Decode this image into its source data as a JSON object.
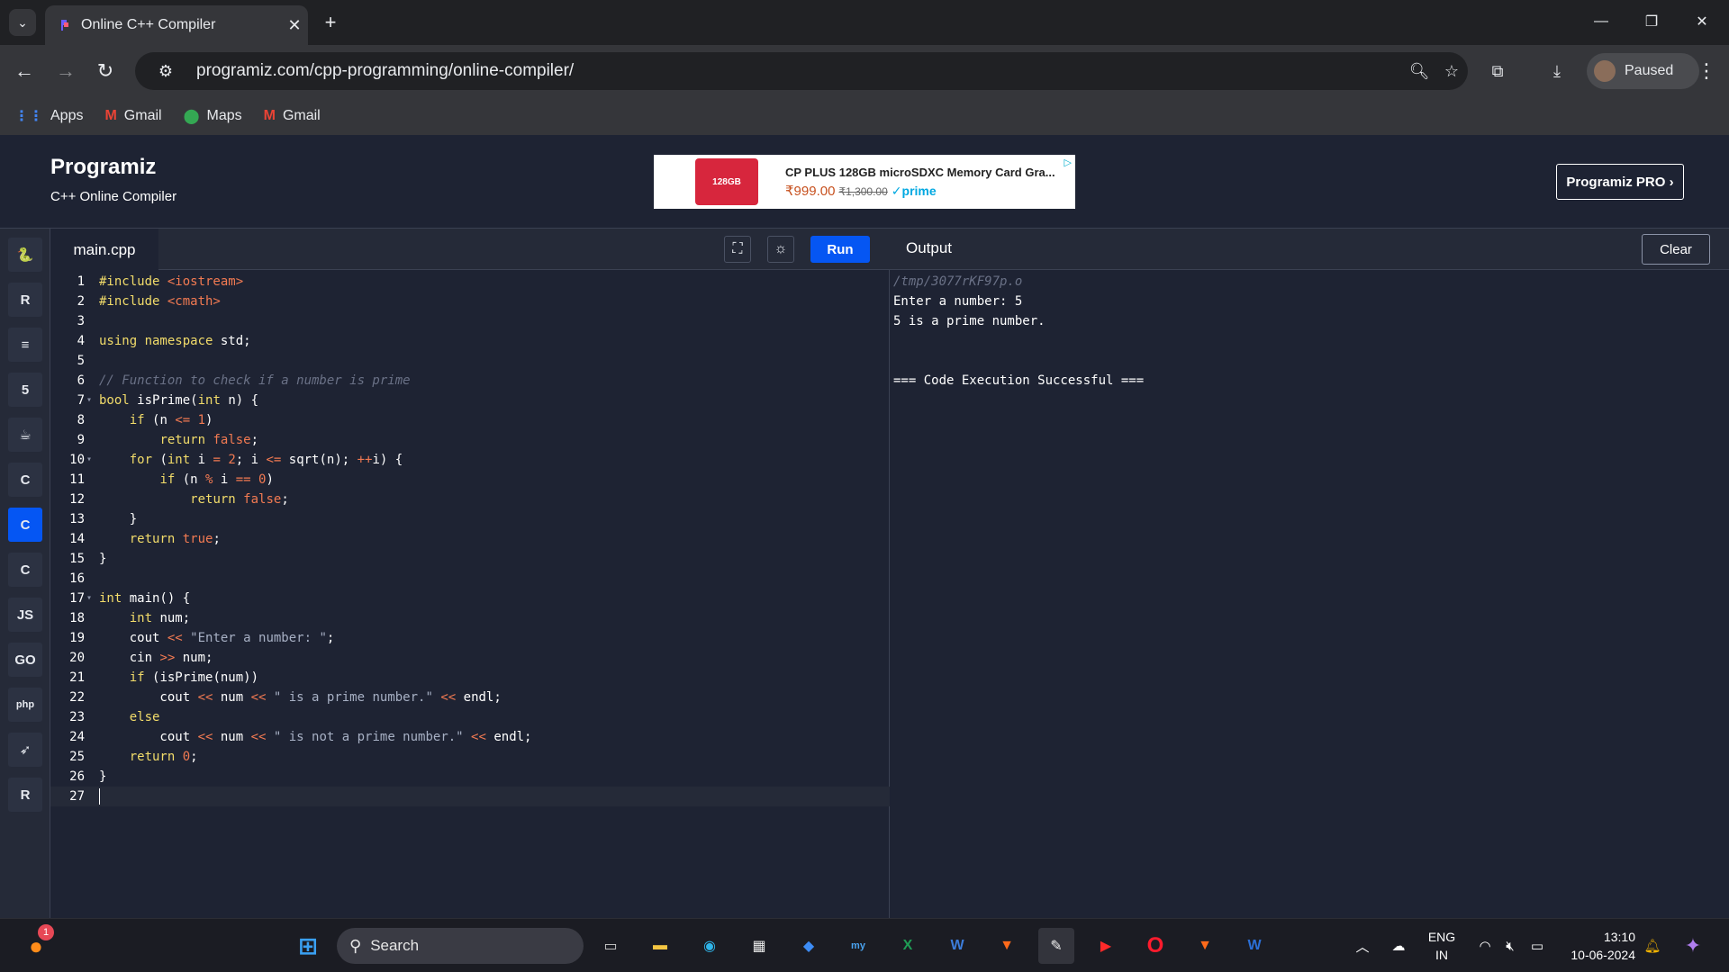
{
  "browser": {
    "tab_title": "Online C++ Compiler",
    "url": "programiz.com/cpp-programming/online-compiler/",
    "profile_status": "Paused",
    "bookmarks": [
      {
        "label": "Apps",
        "icon": "apps-grid-icon"
      },
      {
        "label": "Gmail",
        "icon": "gmail-icon"
      },
      {
        "label": "Maps",
        "icon": "maps-icon"
      },
      {
        "label": "Gmail",
        "icon": "gmail-icon"
      }
    ]
  },
  "site": {
    "logo": "Programiz",
    "subtitle": "C++ Online Compiler",
    "pro_button": "Programiz PRO ›",
    "ad": {
      "brand": "CP PLUS",
      "badge": "128GB",
      "title": "CP PLUS 128GB microSDXC Memory Card Gra...",
      "price": "₹999.00",
      "old_price": "₹1,300.00",
      "prime": "✓prime"
    }
  },
  "languages": [
    {
      "name": "python-icon",
      "glyph": "🐍"
    },
    {
      "name": "r-icon",
      "glyph": "R"
    },
    {
      "name": "sql-icon",
      "glyph": "≡"
    },
    {
      "name": "html-icon",
      "glyph": "5"
    },
    {
      "name": "java-icon",
      "glyph": "☕"
    },
    {
      "name": "c-icon",
      "glyph": "C"
    },
    {
      "name": "cpp-icon",
      "glyph": "C",
      "active": true
    },
    {
      "name": "csharp-icon",
      "glyph": "C"
    },
    {
      "name": "js-icon",
      "glyph": "JS"
    },
    {
      "name": "go-icon",
      "glyph": "GO"
    },
    {
      "name": "php-icon",
      "glyph": "php"
    },
    {
      "name": "swift-icon",
      "glyph": "➶"
    },
    {
      "name": "rust-icon",
      "glyph": "R"
    }
  ],
  "editor": {
    "filename": "main.cpp",
    "run_label": "Run",
    "lines": [
      {
        "n": "1",
        "tokens": [
          [
            "kw-inc",
            "#include "
          ],
          [
            "inc",
            "<iostream>"
          ]
        ]
      },
      {
        "n": "2",
        "tokens": [
          [
            "kw-inc",
            "#include "
          ],
          [
            "inc",
            "<cmath>"
          ]
        ]
      },
      {
        "n": "3",
        "tokens": []
      },
      {
        "n": "4",
        "tokens": [
          [
            "kw",
            "using namespace "
          ],
          [
            "plain",
            "std;"
          ]
        ]
      },
      {
        "n": "5",
        "tokens": []
      },
      {
        "n": "6",
        "tokens": [
          [
            "cmt",
            "// Function to check if a number is prime"
          ]
        ]
      },
      {
        "n": "7",
        "fold": true,
        "tokens": [
          [
            "kw",
            "bool "
          ],
          [
            "plain",
            "isPrime("
          ],
          [
            "kw",
            "int "
          ],
          [
            "plain",
            "n) {"
          ]
        ]
      },
      {
        "n": "8",
        "tokens": [
          [
            "plain",
            "    "
          ],
          [
            "kw",
            "if "
          ],
          [
            "plain",
            "(n "
          ],
          [
            "op",
            "<= "
          ],
          [
            "num",
            "1"
          ],
          [
            "plain",
            ")"
          ]
        ]
      },
      {
        "n": "9",
        "tokens": [
          [
            "plain",
            "        "
          ],
          [
            "kw",
            "return "
          ],
          [
            "num",
            "false"
          ],
          [
            "plain",
            ";"
          ]
        ]
      },
      {
        "n": "10",
        "fold": true,
        "tokens": [
          [
            "plain",
            "    "
          ],
          [
            "kw",
            "for "
          ],
          [
            "plain",
            "("
          ],
          [
            "kw",
            "int "
          ],
          [
            "plain",
            "i "
          ],
          [
            "op",
            "= "
          ],
          [
            "num",
            "2"
          ],
          [
            "plain",
            "; i "
          ],
          [
            "op",
            "<= "
          ],
          [
            "plain",
            "sqrt(n); "
          ],
          [
            "op",
            "++"
          ],
          [
            "plain",
            "i) {"
          ]
        ]
      },
      {
        "n": "11",
        "tokens": [
          [
            "plain",
            "        "
          ],
          [
            "kw",
            "if "
          ],
          [
            "plain",
            "(n "
          ],
          [
            "op",
            "% "
          ],
          [
            "plain",
            "i "
          ],
          [
            "op",
            "== "
          ],
          [
            "num",
            "0"
          ],
          [
            "plain",
            ")"
          ]
        ]
      },
      {
        "n": "12",
        "tokens": [
          [
            "plain",
            "            "
          ],
          [
            "kw",
            "return "
          ],
          [
            "num",
            "false"
          ],
          [
            "plain",
            ";"
          ]
        ]
      },
      {
        "n": "13",
        "tokens": [
          [
            "plain",
            "    }"
          ]
        ]
      },
      {
        "n": "14",
        "tokens": [
          [
            "plain",
            "    "
          ],
          [
            "kw",
            "return "
          ],
          [
            "num",
            "true"
          ],
          [
            "plain",
            ";"
          ]
        ]
      },
      {
        "n": "15",
        "tokens": [
          [
            "plain",
            "}"
          ]
        ]
      },
      {
        "n": "16",
        "tokens": []
      },
      {
        "n": "17",
        "fold": true,
        "tokens": [
          [
            "kw",
            "int "
          ],
          [
            "plain",
            "main() {"
          ]
        ]
      },
      {
        "n": "18",
        "tokens": [
          [
            "plain",
            "    "
          ],
          [
            "kw",
            "int "
          ],
          [
            "plain",
            "num;"
          ]
        ]
      },
      {
        "n": "19",
        "tokens": [
          [
            "plain",
            "    cout "
          ],
          [
            "op",
            "<< "
          ],
          [
            "str",
            "\"Enter a number: \""
          ],
          [
            "plain",
            ";"
          ]
        ]
      },
      {
        "n": "20",
        "tokens": [
          [
            "plain",
            "    cin "
          ],
          [
            "op",
            ">> "
          ],
          [
            "plain",
            "num;"
          ]
        ]
      },
      {
        "n": "21",
        "tokens": [
          [
            "plain",
            "    "
          ],
          [
            "kw",
            "if "
          ],
          [
            "plain",
            "(isPrime(num))"
          ]
        ]
      },
      {
        "n": "22",
        "tokens": [
          [
            "plain",
            "        cout "
          ],
          [
            "op",
            "<< "
          ],
          [
            "plain",
            "num "
          ],
          [
            "op",
            "<< "
          ],
          [
            "str",
            "\" is a prime number.\""
          ],
          [
            "plain",
            " "
          ],
          [
            "op",
            "<< "
          ],
          [
            "plain",
            "endl;"
          ]
        ]
      },
      {
        "n": "23",
        "tokens": [
          [
            "plain",
            "    "
          ],
          [
            "kw",
            "else"
          ]
        ]
      },
      {
        "n": "24",
        "tokens": [
          [
            "plain",
            "        cout "
          ],
          [
            "op",
            "<< "
          ],
          [
            "plain",
            "num "
          ],
          [
            "op",
            "<< "
          ],
          [
            "str",
            "\" is not a prime number.\""
          ],
          [
            "plain",
            " "
          ],
          [
            "op",
            "<< "
          ],
          [
            "plain",
            "endl;"
          ]
        ]
      },
      {
        "n": "25",
        "tokens": [
          [
            "plain",
            "    "
          ],
          [
            "kw",
            "return "
          ],
          [
            "num",
            "0"
          ],
          [
            "plain",
            ";"
          ]
        ]
      },
      {
        "n": "26",
        "tokens": [
          [
            "plain",
            "}"
          ]
        ]
      },
      {
        "n": "27",
        "current": true,
        "tokens": []
      }
    ]
  },
  "output": {
    "title": "Output",
    "clear_label": "Clear",
    "lines": [
      {
        "text": "/tmp/3077rKF97p.o",
        "path": true
      },
      {
        "text": "Enter a number: 5"
      },
      {
        "text": "5 is a prime number."
      },
      {
        "text": ""
      },
      {
        "text": ""
      },
      {
        "text": "=== Code Execution Successful ==="
      }
    ]
  },
  "taskbar": {
    "search_label": "Search",
    "notification_count": "1",
    "language": "ENG",
    "region": "IN",
    "time": "13:10",
    "date": "10-06-2024"
  },
  "colors": {
    "accent": "#0556f3",
    "background": "#1e2333",
    "panel": "#252a38"
  }
}
